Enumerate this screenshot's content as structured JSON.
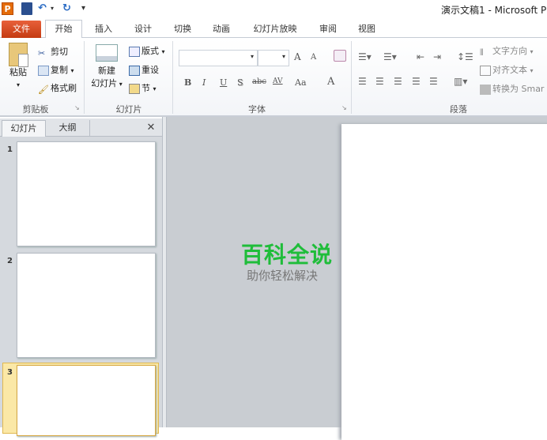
{
  "window": {
    "title": "演示文稿1 - Microsoft P"
  },
  "quick_access": {
    "app_icon": "P",
    "save": "save-icon",
    "undo": "undo-icon",
    "redo": "redo-icon",
    "customize": "▾"
  },
  "tabs": [
    "文件",
    "开始",
    "插入",
    "设计",
    "切换",
    "动画",
    "幻灯片放映",
    "审阅",
    "视图"
  ],
  "ribbon": {
    "clipboard": {
      "label": "剪贴板",
      "paste": "粘贴",
      "cut": "剪切",
      "copy": "复制",
      "format_painter": "格式刷"
    },
    "slides": {
      "label": "幻灯片",
      "new_slide_1": "新建",
      "new_slide_2": "幻灯片",
      "layout": "版式",
      "reset": "重设",
      "section": "节"
    },
    "font": {
      "label": "字体",
      "font_name": "",
      "font_size": "",
      "grow": "A",
      "shrink": "A",
      "bold": "B",
      "italic": "I",
      "underline": "U",
      "shadow": "S",
      "strike": "abc",
      "spacing": "AV",
      "case": "Aa",
      "color": "A"
    },
    "paragraph": {
      "label": "段落",
      "text_direction": "文字方向",
      "align_text": "对齐文本",
      "convert_smartart": "转换为 Smar"
    }
  },
  "panel": {
    "tabs": [
      "幻灯片",
      "大纲"
    ],
    "close": "✕",
    "slides": [
      "1",
      "2",
      "3"
    ],
    "selected": 3
  },
  "watermark": {
    "title": "百科全说",
    "subtitle": "助你轻松解决"
  }
}
